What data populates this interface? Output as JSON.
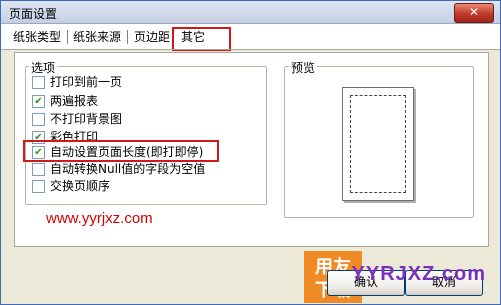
{
  "window": {
    "title": "页面设置",
    "close_glyph": "✕"
  },
  "tabs": [
    {
      "label": "纸张类型"
    },
    {
      "label": "纸张来源"
    },
    {
      "label": "页边距"
    },
    {
      "label": "其它",
      "active": true
    }
  ],
  "options_group": {
    "label": "选项",
    "items": [
      {
        "label": "打印到前一页",
        "checked": false
      },
      {
        "label": "两遍报表",
        "checked": true
      },
      {
        "label": "不打印背景图",
        "checked": false
      },
      {
        "label": "彩色打印",
        "checked": true
      },
      {
        "label": "自动设置页面长度(即打即停)",
        "checked": true
      },
      {
        "label": "自动转换Null值的字段为空值",
        "checked": false
      },
      {
        "label": "交换页顺序",
        "checked": false
      }
    ]
  },
  "preview_group": {
    "label": "预览"
  },
  "watermark": {
    "text": "www.yyrjxz.com"
  },
  "buttons": {
    "ok": "确认",
    "cancel": "取消"
  },
  "logo": {
    "line1": "用友",
    "line2": "下载",
    "text": "YYRJXZ.com"
  },
  "colors": {
    "highlight": "#d01a1a",
    "check": "#21a121",
    "watermark": "#d40000"
  }
}
